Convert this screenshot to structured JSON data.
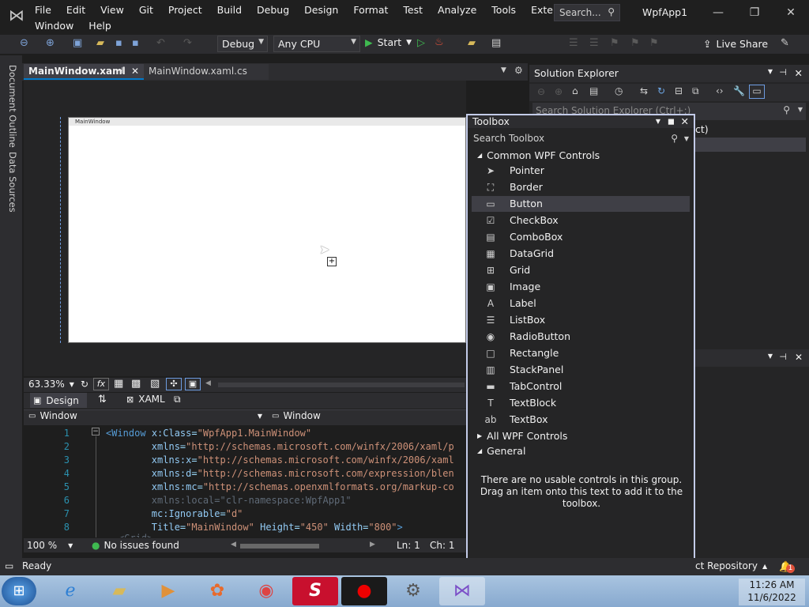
{
  "menu": {
    "row1": [
      "File",
      "Edit",
      "View",
      "Git",
      "Project",
      "Build",
      "Debug",
      "Design",
      "Format",
      "Test",
      "Analyze",
      "Tools",
      "Extensions"
    ],
    "row2": [
      "Window",
      "Help"
    ]
  },
  "search": {
    "placeholder": "Search..."
  },
  "app_title": "WpfApp1",
  "toolbar": {
    "config": "Debug",
    "platform": "Any CPU",
    "start_label": "Start",
    "liveshare_label": "Live Share"
  },
  "left_tabs": [
    "Document Outline",
    "Data Sources"
  ],
  "doc_tabs": {
    "active": "MainWindow.xaml",
    "inactive": "MainWindow.xaml.cs"
  },
  "designer": {
    "window_title": "MainWindow",
    "zoom": "63.33%"
  },
  "split": {
    "design": "Design",
    "xaml": "XAML"
  },
  "nav": {
    "left": "Window",
    "right": "Window"
  },
  "code_lines": [
    {
      "n": "1",
      "html": "<span class=\"c-tag\">&lt;Window</span> <span class=\"c-attr\">x:Class</span>=<span class=\"c-str\">\"WpfApp1.MainWindow\"</span>"
    },
    {
      "n": "2",
      "html": "        <span class=\"c-attr\">xmlns</span>=<span class=\"c-str\">\"http://schemas.microsoft.com/winfx/2006/xaml/p</span>"
    },
    {
      "n": "3",
      "html": "        <span class=\"c-attr\">xmlns:x</span>=<span class=\"c-str\">\"http://schemas.microsoft.com/winfx/2006/xaml</span>"
    },
    {
      "n": "4",
      "html": "        <span class=\"c-attr\">xmlns:d</span>=<span class=\"c-str\">\"http://schemas.microsoft.com/expression/blen</span>"
    },
    {
      "n": "5",
      "html": "        <span class=\"c-attr\">xmlns:mc</span>=<span class=\"c-str\">\"http://schemas.openxmlformats.org/markup-co</span>"
    },
    {
      "n": "6",
      "html": "        <span class=\"c-faded\">xmlns:local=\"clr-namespace:WpfApp1\"</span>"
    },
    {
      "n": "7",
      "html": "        <span class=\"c-attr\">mc:Ignorable</span>=<span class=\"c-str\">\"d\"</span>"
    },
    {
      "n": "8",
      "html": "        <span class=\"c-attr\">Title</span>=<span class=\"c-str\">\"MainWindow\"</span> <span class=\"c-attr\">Height</span>=<span class=\"c-str\">\"450\"</span> <span class=\"c-attr\">Width</span>=<span class=\"c-str\">\"800\"</span><span class=\"c-tag\">&gt;</span>"
    }
  ],
  "code_status": {
    "zoom": "100 %",
    "issues": "No issues found",
    "ln": "Ln: 1",
    "ch": "Ch: 1"
  },
  "solution": {
    "title": "Solution Explorer",
    "search": "Search Solution Explorer (Ctrl+;)",
    "tree_fragment": "ct)"
  },
  "toolbox": {
    "title": "Toolbox",
    "search": "Search Toolbox",
    "group_common": "Common WPF Controls",
    "items": [
      {
        "label": "Pointer",
        "icon": "pointer-icon",
        "glyph": "➤"
      },
      {
        "label": "Border",
        "icon": "border-icon",
        "glyph": "⛶"
      },
      {
        "label": "Button",
        "icon": "button-icon",
        "glyph": "▭"
      },
      {
        "label": "CheckBox",
        "icon": "checkbox-icon",
        "glyph": "☑"
      },
      {
        "label": "ComboBox",
        "icon": "combobox-icon",
        "glyph": "▤"
      },
      {
        "label": "DataGrid",
        "icon": "datagrid-icon",
        "glyph": "▦"
      },
      {
        "label": "Grid",
        "icon": "grid-icon",
        "glyph": "⊞"
      },
      {
        "label": "Image",
        "icon": "image-icon",
        "glyph": "▣"
      },
      {
        "label": "Label",
        "icon": "label-icon",
        "glyph": "A"
      },
      {
        "label": "ListBox",
        "icon": "listbox-icon",
        "glyph": "☰"
      },
      {
        "label": "RadioButton",
        "icon": "radiobutton-icon",
        "glyph": "◉"
      },
      {
        "label": "Rectangle",
        "icon": "rectangle-icon",
        "glyph": "□"
      },
      {
        "label": "StackPanel",
        "icon": "stackpanel-icon",
        "glyph": "▥"
      },
      {
        "label": "TabControl",
        "icon": "tabcontrol-icon",
        "glyph": "▬"
      },
      {
        "label": "TextBlock",
        "icon": "textblock-icon",
        "glyph": "T"
      },
      {
        "label": "TextBox",
        "icon": "textbox-icon",
        "glyph": "ab"
      }
    ],
    "selected_index": 2,
    "group_all": "All WPF Controls",
    "group_general": "General",
    "empty_msg": "There are no usable controls in this group. Drag an item onto this text to add it to the toolbox."
  },
  "status": {
    "ready": "Ready",
    "repo": "ct Repository",
    "notif_count": "1"
  },
  "clock": {
    "time": "11:26 AM",
    "date": "11/6/2022"
  },
  "colors": {
    "accent": "#007acc",
    "selection": "#3f3f46",
    "toolbox_border": "#c3cbe8"
  }
}
